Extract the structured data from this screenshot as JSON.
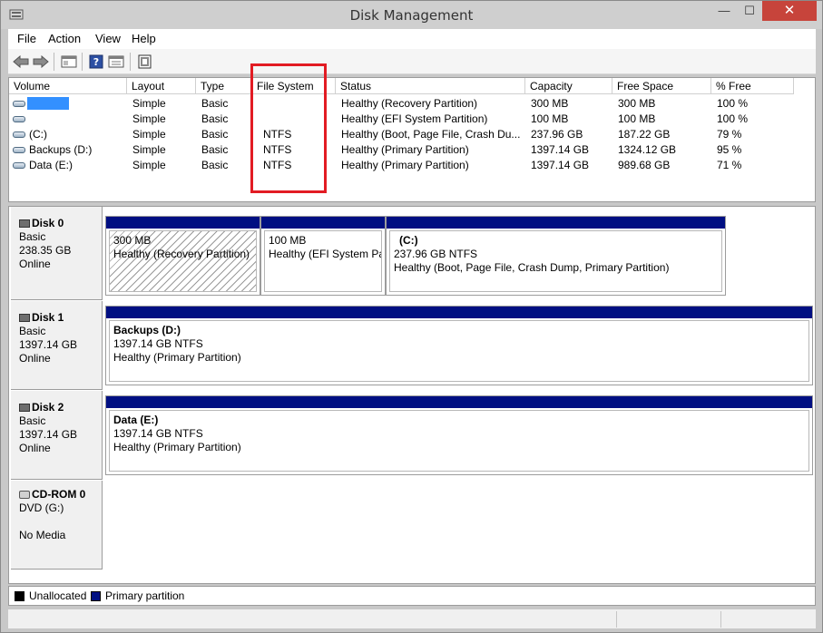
{
  "window": {
    "title": "Disk Management",
    "controls": {
      "minimize": "—",
      "maximize": "☐",
      "close": "✕"
    }
  },
  "menu": [
    {
      "label": "File"
    },
    {
      "label": "Action"
    },
    {
      "label": "View"
    },
    {
      "label": "Help"
    }
  ],
  "toolbar": [
    "back-icon",
    "forward-icon",
    "properties-icon",
    "help-icon",
    "console-icon",
    "refresh-icon"
  ],
  "volumes": {
    "headers": [
      "Volume",
      "Layout",
      "Type",
      "File System",
      "Status",
      "Capacity",
      "Free Space",
      "% Free"
    ],
    "rows": [
      [
        "",
        "Simple",
        "Basic",
        "",
        "Healthy (Recovery Partition)",
        "300 MB",
        "300 MB",
        "100 %"
      ],
      [
        "",
        "Simple",
        "Basic",
        "",
        "Healthy (EFI System Partition)",
        "100 MB",
        "100 MB",
        "100 %"
      ],
      [
        "(C:)",
        "Simple",
        "Basic",
        "NTFS",
        "Healthy (Boot, Page File, Crash Du...",
        "237.96 GB",
        "187.22 GB",
        "79 %"
      ],
      [
        "Backups (D:)",
        "Simple",
        "Basic",
        "NTFS",
        "Healthy (Primary Partition)",
        "1397.14 GB",
        "1324.12 GB",
        "95 %"
      ],
      [
        "Data (E:)",
        "Simple",
        "Basic",
        "NTFS",
        "Healthy (Primary Partition)",
        "1397.14 GB",
        "989.68 GB",
        "71 %"
      ]
    ]
  },
  "disks": [
    {
      "name": "Disk 0",
      "type": "Basic",
      "size": "238.35 GB",
      "state": "Online",
      "partitions": [
        {
          "title": "",
          "size": "300 MB",
          "status": "Healthy (Recovery Partition)"
        },
        {
          "title": "",
          "size": "100 MB",
          "status": "Healthy (EFI System Par"
        },
        {
          "title": "(C:)",
          "size": "237.96 GB NTFS",
          "status": "Healthy (Boot, Page File, Crash Dump, Primary Partition)"
        }
      ]
    },
    {
      "name": "Disk 1",
      "type": "Basic",
      "size": "1397.14 GB",
      "state": "Online",
      "partitions": [
        {
          "title": "Backups  (D:)",
          "size": "1397.14 GB NTFS",
          "status": "Healthy (Primary Partition)"
        }
      ]
    },
    {
      "name": "Disk 2",
      "type": "Basic",
      "size": "1397.14 GB",
      "state": "Online",
      "partitions": [
        {
          "title": "Data  (E:)",
          "size": "1397.14 GB NTFS",
          "status": "Healthy (Primary Partition)"
        }
      ]
    },
    {
      "name": "CD-ROM 0",
      "type": "DVD (G:)",
      "size": "",
      "state": "No Media",
      "partitions": []
    }
  ],
  "legend": [
    {
      "label": "Unallocated",
      "color": "#000000"
    },
    {
      "label": "Primary partition",
      "color": "#000f82"
    }
  ],
  "colors": {
    "partition_bar": "#000f82",
    "selection": "#3390ff",
    "highlight_box": "#e21b23",
    "close_button": "#c7443b"
  }
}
